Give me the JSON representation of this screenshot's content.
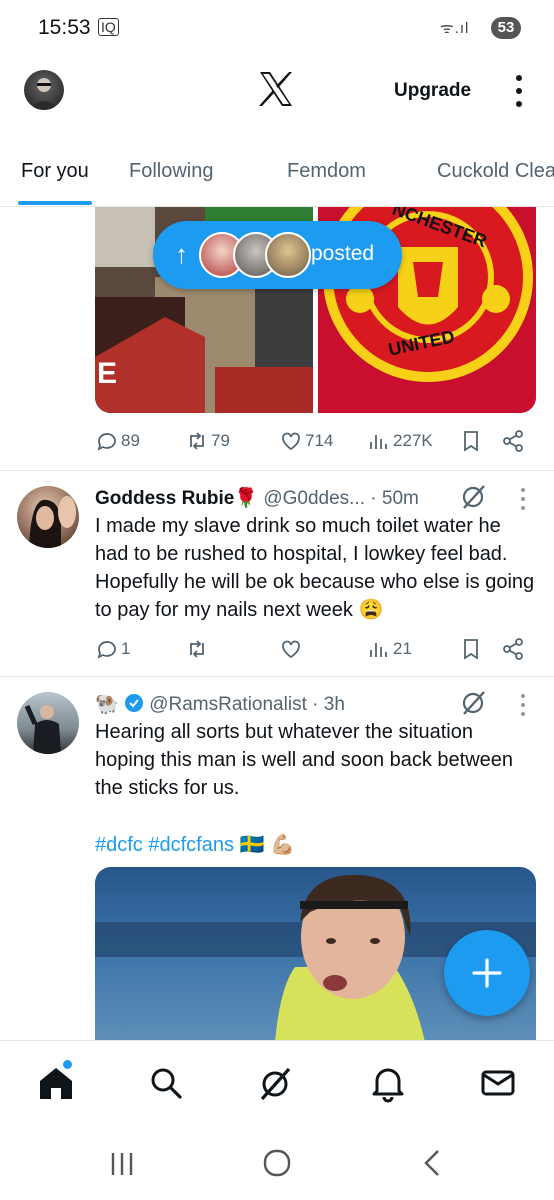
{
  "status_bar": {
    "time": "15:53",
    "iq_label": "IQ",
    "signal_glyphs": "ᯤ.ıl",
    "battery": "53"
  },
  "header": {
    "upgrade_label": "Upgrade",
    "logo": "x-logo-icon"
  },
  "tabs": [
    {
      "label": "For you",
      "active": true
    },
    {
      "label": "Following",
      "active": false
    },
    {
      "label": "Femdom",
      "active": false
    },
    {
      "label": "Cuckold Clea",
      "active": false
    }
  ],
  "posted_pill": {
    "label": "posted",
    "arrow": "↑"
  },
  "post1": {
    "media_right_text_top": "NCHESTER",
    "media_right_text_bottom": "UNITED",
    "media_left_text": "E",
    "actions": {
      "replies": "89",
      "reposts": "79",
      "likes": "714",
      "views": "227K"
    }
  },
  "tweet2": {
    "name": "Goddess Rubie",
    "emoji": "🌹",
    "handle": "@G0ddes...",
    "time": "· 50m",
    "text": "I made my slave drink so much toilet water he had to be rushed to hospital, I lowkey feel bad. Hopefully he will be ok because who else is going to pay for my nails next week 😩",
    "actions": {
      "replies": "1",
      "reposts": "",
      "likes": "",
      "views": "21"
    }
  },
  "tweet3": {
    "name": "🐏",
    "handle": "@RamsRationalist",
    "time": "· 3h",
    "text": "Hearing all sorts but whatever the situation hoping this man is well and soon back between the sticks for us.",
    "hashtags": "#dcfc #dcfcfans 🇸🇪 💪🏼"
  },
  "fab": {
    "label": "+"
  },
  "bottom_nav": [
    "home-icon",
    "search-icon",
    "grok-icon",
    "notifications-icon",
    "messages-icon"
  ],
  "colors": {
    "accent": "#1d9bf0",
    "text": "#0f1419",
    "muted": "#536471",
    "verified": "#1d9bf0"
  }
}
